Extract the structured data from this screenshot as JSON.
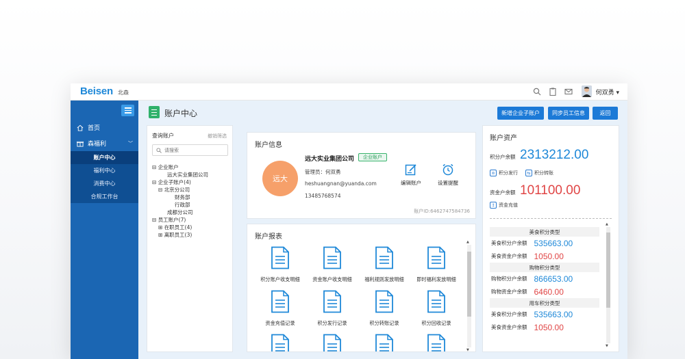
{
  "topbar": {
    "logo": "Beisen",
    "logo_sub": "北森",
    "username": "何双勇 ▾"
  },
  "sidebar": {
    "items": [
      {
        "label": "首页",
        "icon": "home-icon"
      },
      {
        "label": "森福利",
        "icon": "gift-icon"
      }
    ],
    "sub_items": [
      {
        "label": "账户中心",
        "active": true
      },
      {
        "label": "福利中心",
        "active": false
      },
      {
        "label": "消费中心",
        "active": false
      },
      {
        "label": "合规工作台",
        "active": false
      }
    ]
  },
  "header": {
    "title": "账户中心",
    "buttons": {
      "add_sub_account": "新增企业子账户",
      "sync_staff": "同步员工信息",
      "back": "返回"
    }
  },
  "tree_panel": {
    "title": "查询账户",
    "clear_link": "撤销筛选",
    "search_placeholder": "请搜索",
    "nodes": [
      {
        "label": "企业账户",
        "toggle": "⊟",
        "level": 0
      },
      {
        "label": "远大实业集团公司",
        "toggle": "",
        "level": 2
      },
      {
        "label": "企业子账户(4)",
        "toggle": "⊟",
        "level": 0
      },
      {
        "label": "北京分公司",
        "toggle": "⊟",
        "level": 1
      },
      {
        "label": "财务部",
        "toggle": "",
        "level": 3
      },
      {
        "label": "行政部",
        "toggle": "",
        "level": 3
      },
      {
        "label": "成都分公司",
        "toggle": "",
        "level": 2
      },
      {
        "label": "员工账户(7)",
        "toggle": "⊟",
        "level": 0
      },
      {
        "label": "在职员工(4)",
        "toggle": "⊞",
        "level": 1
      },
      {
        "label": "离职员工(3)",
        "toggle": "⊞",
        "level": 1
      }
    ]
  },
  "account_info": {
    "title": "账户信息",
    "avatar_text": "远大",
    "org_name": "远大实业集团公司",
    "badge": "企业账户",
    "admin": "管理员：何双勇",
    "email": "heshuangnan@yuanda.com",
    "phone": "13485768574",
    "actions": [
      "编辑账户",
      "设置提醒"
    ],
    "account_id": "账户ID:6462747584736"
  },
  "reports": {
    "title": "账户报表",
    "items": [
      "积分账户收支明细",
      "资金账户收支明细",
      "福利规则发放明细",
      "即时福利发放明细",
      "资金充值记录",
      "积分发行记录",
      "积分转账记录",
      "积分回收记录",
      "",
      "",
      "",
      ""
    ]
  },
  "assets": {
    "title": "账户资产",
    "points_label": "积分户余额",
    "points_value": "2313212.00",
    "points_issue": "积分发行",
    "points_transfer": "积分转账",
    "fund_label": "资金户余额",
    "fund_value": "101100.00",
    "fund_recharge": "资金充值",
    "types": [
      {
        "head": "美食积分类型",
        "points_label": "美食积分户余额",
        "points": "535663.00",
        "fund_label": "美食资金户余额",
        "fund": "1050.00"
      },
      {
        "head": "购物积分类型",
        "points_label": "购物积分户余额",
        "points": "866653.00",
        "fund_label": "购物资金户余额",
        "fund": "6460.00"
      },
      {
        "head": "用车积分类型",
        "points_label": "美食积分户余额",
        "points": "535663.00",
        "fund_label": "美食资金户余额",
        "fund": "1050.00"
      }
    ]
  },
  "colors": {
    "sidebar": "#1b66b3",
    "accent": "#1c7ad7",
    "points": "#1e88d8",
    "fund": "#e04545",
    "avatar": "#f6a06a"
  }
}
